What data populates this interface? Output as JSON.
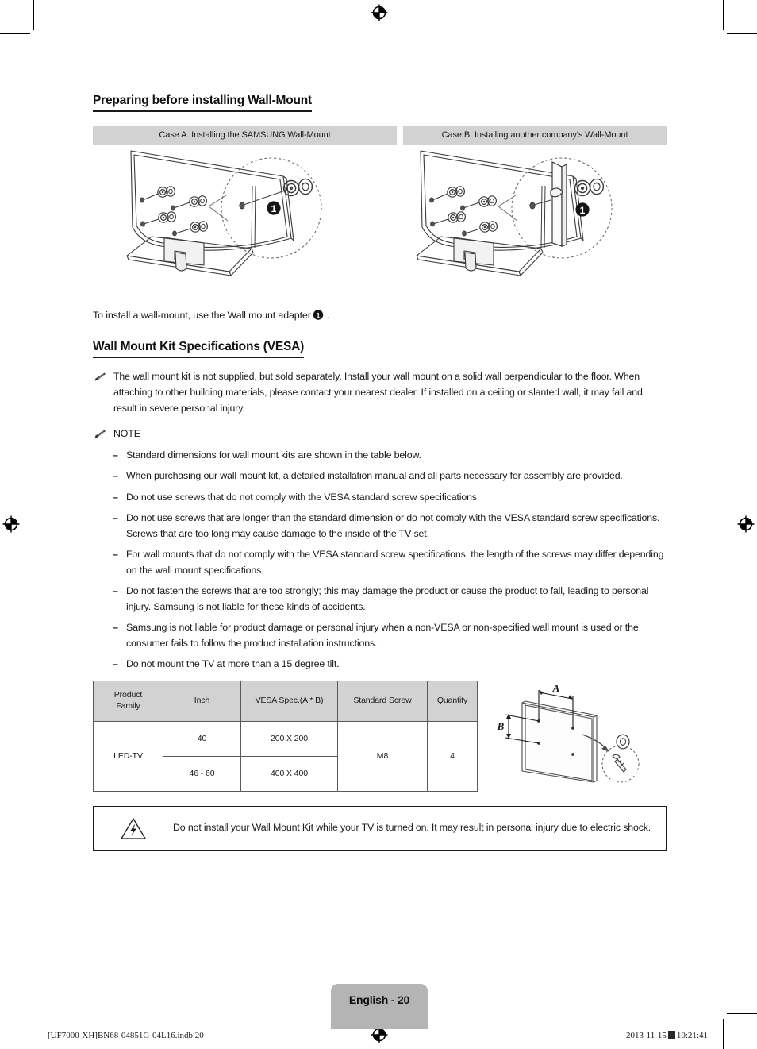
{
  "document": {
    "section1_title": "Preparing before installing Wall-Mount",
    "section2_title": "Wall Mount Kit Specifications (VESA)"
  },
  "cases": {
    "case_a_label": "Case A. Installing the SAMSUNG Wall-Mount",
    "case_b_label": "Case B. Installing another company's Wall-Mount",
    "marker": "1"
  },
  "lead_text": "To install a wall-mount, use the Wall mount adapter",
  "lead_text_tail": ".",
  "vesa_intro": "The wall mount kit is not supplied, but sold separately. Install your wall mount on a solid wall perpendicular to the floor. When attaching to other building materials, please contact your nearest dealer. If installed on a ceiling or slanted wall, it may fall and result in severe personal injury.",
  "note": {
    "title": "NOTE",
    "items": [
      "Standard dimensions for wall mount kits are shown in the table below.",
      "When purchasing our wall mount kit, a detailed installation manual and all parts necessary for assembly are provided.",
      "Do not use screws that do not comply with the VESA standard screw specifications.",
      "Do not use screws that are longer than the standard dimension or do not comply with the VESA standard screw specifications. Screws that are too long may cause damage to the inside of the TV set.",
      "For wall mounts that do not comply with the VESA standard screw specifications, the length of the screws may differ depending on the wall mount specifications.",
      "Do not fasten the screws that are too strongly; this may damage the product or cause the product to fall, leading to personal injury. Samsung is not liable for these kinds of accidents.",
      "Samsung is not liable for product damage or personal injury when a non-VESA or non-specified wall mount is used or the consumer fails to follow the product installation instructions.",
      "Do not mount the TV at more than a 15 degree tilt."
    ]
  },
  "spec_table": {
    "headers": [
      "Product Family",
      "Inch",
      "VESA Spec.(A * B)",
      "Standard Screw",
      "Quantity"
    ],
    "header_line1": "Product",
    "header_line2": "Family",
    "rows": [
      {
        "product_family": "LED-TV",
        "inch": "40",
        "vesa_spec": "200 X 200",
        "standard_screw": "M8",
        "quantity": "4"
      },
      {
        "inch": "46 - 60",
        "vesa_spec": "400 X 400"
      }
    ]
  },
  "figure": {
    "label_a": "A",
    "label_b": "B"
  },
  "warning": {
    "text": "Do not install your Wall Mount Kit while your TV is turned on. It may result in personal injury due to electric shock."
  },
  "footer": {
    "page_label": "English - 20",
    "file_ref": "[UF7000-XH]BN68-04851G-04L16.indb   20",
    "date": "2013-11-15",
    "time": "10:21:41"
  },
  "colors": {
    "header_gray": "#d2d2d2",
    "tab_gray": "#b4b4b4",
    "text": "#1a1a1a",
    "line": "#595959"
  }
}
